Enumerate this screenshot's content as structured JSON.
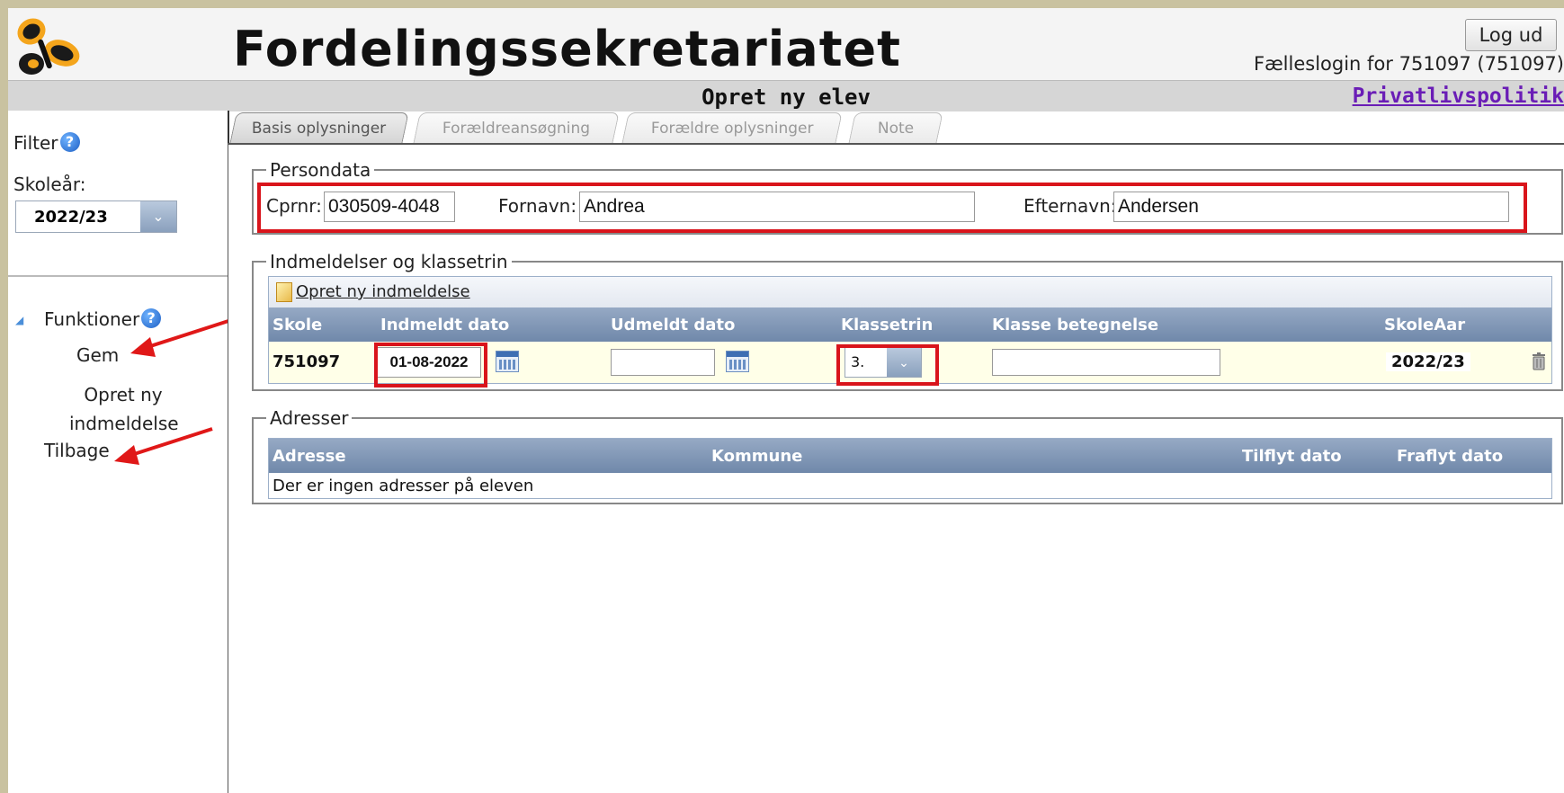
{
  "header": {
    "title": "Fordelingssekretariatet",
    "logout_label": "Log ud",
    "login_info": "Fælleslogin for 751097 (751097)",
    "page_title": "Opret ny elev",
    "privacy_link": "Privatlivspolitik"
  },
  "sidebar": {
    "filter_label": "Filter",
    "school_year_label": "Skoleår:",
    "school_year_value": "2022/23",
    "functions_label": "Funktioner",
    "items": [
      {
        "label": "Gem"
      },
      {
        "label": "Opret ny indmeldelse"
      },
      {
        "label": "Tilbage"
      }
    ]
  },
  "tabs": [
    {
      "label": "Basis oplysninger",
      "active": true
    },
    {
      "label": "Forældreansøgning",
      "active": false
    },
    {
      "label": "Forældre oplysninger",
      "active": false
    },
    {
      "label": "Note",
      "active": false
    }
  ],
  "persondata": {
    "legend": "Persondata",
    "cpr_label": "Cprnr:",
    "cpr_value": "030509-4048",
    "firstname_label": "Fornavn:",
    "firstname_value": "Andrea",
    "lastname_label": "Efternavn:",
    "lastname_value": "Andersen"
  },
  "enrollments": {
    "legend": "Indmeldelser og klassetrin",
    "new_link": "Opret ny indmeldelse",
    "columns": [
      "Skole",
      "Indmeldt dato",
      "Udmeldt dato",
      "Klassetrin",
      "Klasse betegnelse",
      "SkoleAar"
    ],
    "row": {
      "school": "751097",
      "enrolled_date": "01-08-2022",
      "unenrolled_date": "",
      "grade": "3.",
      "class_name": "",
      "school_year": "2022/23"
    }
  },
  "addresses": {
    "legend": "Adresser",
    "columns": [
      "Adresse",
      "Kommune",
      "Tilflyt dato",
      "Fraflyt dato"
    ],
    "empty_message": "Der er ingen adresser på eleven"
  },
  "colors": {
    "highlight_red": "#d9141b",
    "grid_header": "#7088aa",
    "row_bg": "#ffffe8",
    "privacy_link": "#6a1db6"
  }
}
